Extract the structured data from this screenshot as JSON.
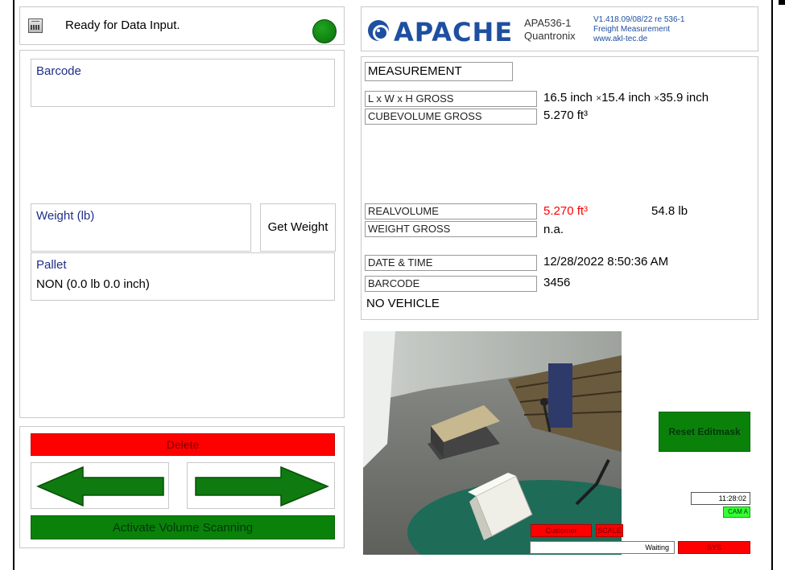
{
  "status": {
    "text": "Ready for Data Input.",
    "indicator_color": "#139313"
  },
  "fields": {
    "barcode_label": "Barcode",
    "weight_label": "Weight (lb)",
    "get_weight_label": "Get Weight",
    "pallet_label": "Pallet",
    "pallet_value": "NON (0.0 lb 0.0 inch)"
  },
  "actions": {
    "delete_label": "Delete",
    "activate_label": "Activate Volume Scanning",
    "prev_icon": "arrow-left-icon",
    "next_icon": "arrow-right-icon"
  },
  "brand": {
    "logo": "APACHE",
    "model": "APA536-1",
    "vendor": "Quantronix",
    "version": "V1.418.09/08/22 re 536-1",
    "product": "Freight Measurement",
    "website": "www.akl-tec.de"
  },
  "measurement": {
    "title": "MEASUREMENT",
    "dims_label": "L x W x H GROSS",
    "length": "16.5 inch",
    "width": "15.4 inch",
    "height": "35.9 inch",
    "times": "×",
    "cubevolume_label": "CUBEVOLUME GROSS",
    "cubevolume_value": "5.270 ft³",
    "realvolume_label": "REALVOLUME",
    "realvolume_value": "5.270 ft³",
    "real_weight": "54.8 lb",
    "weight_gross_label": "WEIGHT GROSS",
    "weight_gross_value": "n.a.",
    "datetime_label": "DATE & TIME",
    "datetime_value": "12/28/2022 8:50:36 AM",
    "barcode_label": "BARCODE",
    "barcode_value": "3456",
    "vehicle": "NO VEHICLE"
  },
  "camera": {
    "reset_label": "Reset Editmask",
    "clock": "11:28:02",
    "cam_label": "CAM A",
    "customer_label": "Customer",
    "scale_label": "SCALE",
    "waiting_label": "Waiting",
    "sys_label": "SYS"
  },
  "colors": {
    "accent_blue": "#1e4fa0",
    "label_blue": "#1d2e86",
    "alert_red": "#ff0000",
    "action_green": "#0a820a"
  }
}
